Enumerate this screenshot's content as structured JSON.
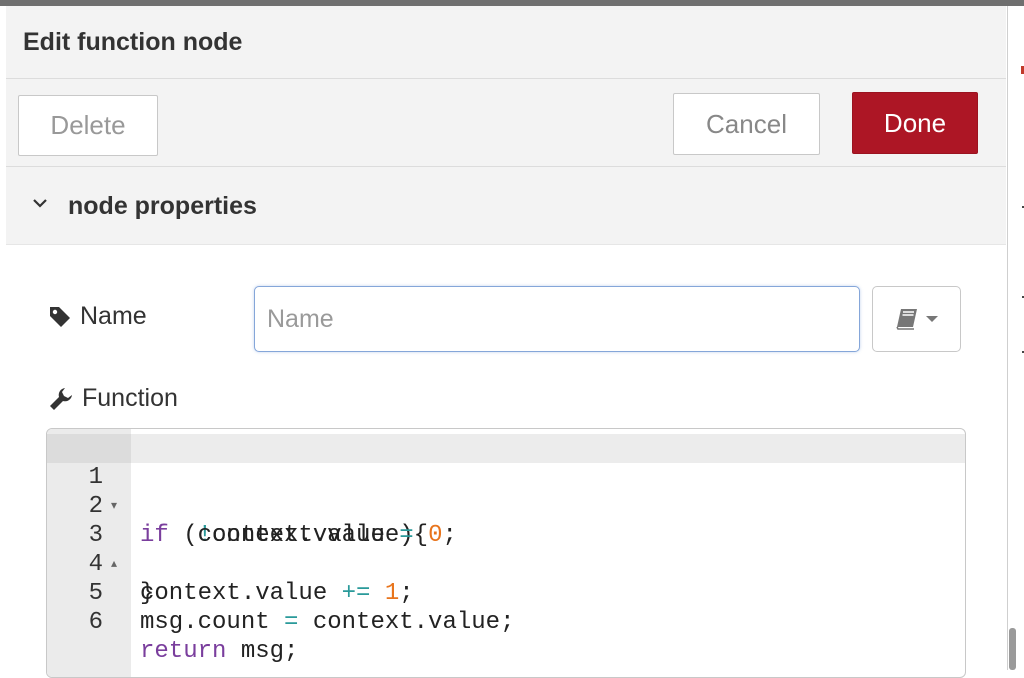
{
  "tray": {
    "title": "Edit function node",
    "buttons": {
      "delete": "Delete",
      "cancel": "Cancel",
      "done": "Done"
    }
  },
  "section": {
    "title": "node properties"
  },
  "fields": {
    "name": {
      "label": "Name",
      "placeholder": "Name",
      "value": ""
    },
    "function": {
      "label": "Function"
    }
  },
  "editor": {
    "lines": [
      {
        "n": "1",
        "fold": "▾"
      },
      {
        "n": "2",
        "fold": ""
      },
      {
        "n": "3",
        "fold": "▴"
      },
      {
        "n": "4",
        "fold": ""
      },
      {
        "n": "5",
        "fold": ""
      },
      {
        "n": "6",
        "fold": ""
      }
    ],
    "code": {
      "l1_kw": "if",
      "l1_open": " (",
      "l1_not": "!",
      "l1_rest": "context.value){",
      "l2_a": "    context.value ",
      "l2_op": "=",
      "l2_sp": " ",
      "l2_num": "0",
      "l2_end": ";",
      "l3": "}",
      "l4_a": "context.value ",
      "l4_op": "+=",
      "l4_sp": " ",
      "l4_num": "1",
      "l4_end": ";",
      "l5_a": "msg.count ",
      "l5_op": "=",
      "l5_b": " context.value;",
      "l6_kw": "return",
      "l6_rest": " msg;"
    }
  },
  "colors": {
    "done_button": "#ad1625",
    "keyword": "#7a3e9d",
    "operator": "#2a9a9a",
    "number": "#e8741c",
    "input_focus_border": "#85a6d9"
  },
  "icons": {
    "section_toggle": "chevron-down-icon",
    "name_field": "tag-icon",
    "function_field": "wrench-icon",
    "library": "book-icon",
    "library_menu": "caret-down-icon"
  }
}
